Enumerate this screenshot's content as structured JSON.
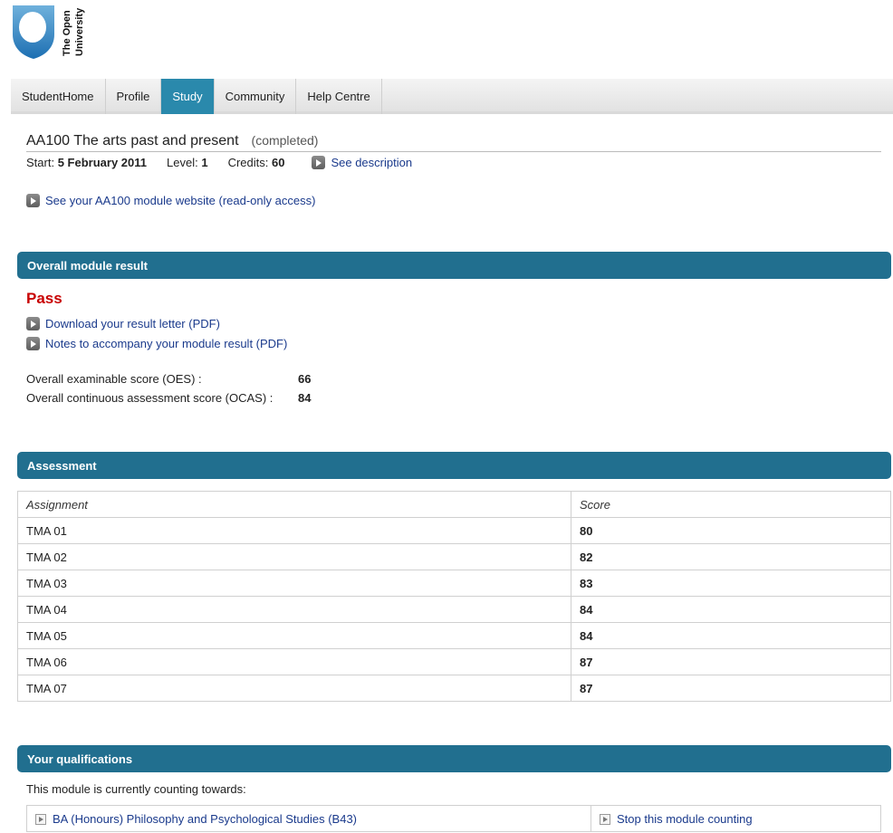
{
  "logo": {
    "line1": "The Open",
    "line2": "University"
  },
  "nav": {
    "tabs": [
      {
        "label": "StudentHome"
      },
      {
        "label": "Profile"
      },
      {
        "label": "Study"
      },
      {
        "label": "Community"
      },
      {
        "label": "Help Centre"
      }
    ],
    "active_tab": "Study"
  },
  "module": {
    "title": "AA100 The arts past and present",
    "status": "(completed)",
    "start_label": "Start:",
    "start_value": "5 February 2011",
    "level_label": "Level:",
    "level_value": "1",
    "credits_label": "Credits:",
    "credits_value": "60",
    "see_description": "See description",
    "website_link": "See your AA100 module website (read-only access)"
  },
  "overall": {
    "heading": "Overall module result",
    "result": "Pass",
    "result_color": "#c80000",
    "download_letter": "Download your result letter (PDF)",
    "notes_link": "Notes to accompany your module result (PDF)",
    "oes_label": "Overall examinable score (OES) :",
    "oes_value": "66",
    "ocas_label": "Overall continuous assessment score (OCAS) :",
    "ocas_value": "84"
  },
  "assessment": {
    "heading": "Assessment",
    "col_assignment": "Assignment",
    "col_score": "Score",
    "rows": [
      {
        "assignment": "TMA 01",
        "score": "80"
      },
      {
        "assignment": "TMA 02",
        "score": "82"
      },
      {
        "assignment": "TMA 03",
        "score": "83"
      },
      {
        "assignment": "TMA 04",
        "score": "84"
      },
      {
        "assignment": "TMA 05",
        "score": "84"
      },
      {
        "assignment": "TMA 06",
        "score": "87"
      },
      {
        "assignment": "TMA 07",
        "score": "87"
      }
    ]
  },
  "qualifications": {
    "heading": "Your qualifications",
    "intro": "This module is currently counting towards:",
    "qualification": "BA (Honours) Philosophy and Psychological Studies (B43)",
    "stop_link": "Stop this module counting"
  },
  "colors": {
    "section_bar": "#216f8f",
    "active_tab": "#2a89ac",
    "link": "#1a3a8c"
  }
}
